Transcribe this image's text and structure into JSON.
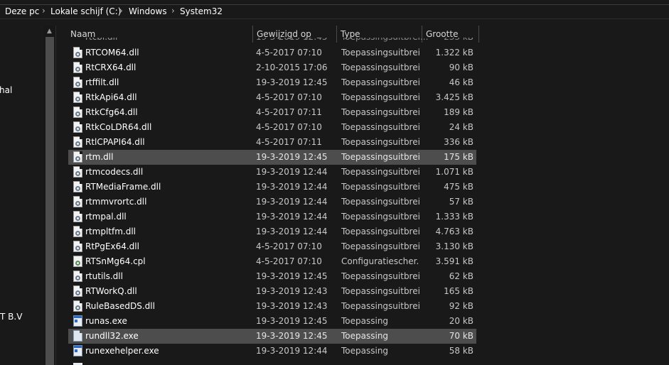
{
  "breadcrumb": {
    "items": [
      "Deze pc",
      "Lokale schijf (C:)",
      "Windows",
      "System32"
    ],
    "separator": "›"
  },
  "navpane": {
    "fragment1": "hal",
    "fragment2": "T B.V"
  },
  "columns": {
    "name": "Naam",
    "modified": "Gewijzigd op",
    "type": "Type",
    "size": "Grootte"
  },
  "files": [
    {
      "name": "RTCOM64.dll",
      "modified": "4-5-2017 07:10",
      "type": "Toepassingsuitbrei...",
      "size": "1.322 kB",
      "icon": "dll-file-icon",
      "selected": false
    },
    {
      "name": "RtCRX64.dll",
      "modified": "2-10-2015 17:06",
      "type": "Toepassingsuitbrei...",
      "size": "90 kB",
      "icon": "dll-file-icon",
      "selected": false
    },
    {
      "name": "rtffilt.dll",
      "modified": "19-3-2019 12:45",
      "type": "Toepassingsuitbrei...",
      "size": "46 kB",
      "icon": "dll-file-icon",
      "selected": false
    },
    {
      "name": "RtkApi64.dll",
      "modified": "4-5-2017 07:10",
      "type": "Toepassingsuitbrei...",
      "size": "3.425 kB",
      "icon": "dll-file-icon",
      "selected": false
    },
    {
      "name": "RtkCfg64.dll",
      "modified": "4-5-2017 07:11",
      "type": "Toepassingsuitbrei...",
      "size": "189 kB",
      "icon": "dll-file-icon",
      "selected": false
    },
    {
      "name": "RtkCoLDR64.dll",
      "modified": "4-5-2017 07:10",
      "type": "Toepassingsuitbrei...",
      "size": "24 kB",
      "icon": "dll-file-icon",
      "selected": false
    },
    {
      "name": "RtlCPAPI64.dll",
      "modified": "4-5-2017 07:11",
      "type": "Toepassingsuitbrei...",
      "size": "336 kB",
      "icon": "dll-file-icon",
      "selected": false
    },
    {
      "name": "rtm.dll",
      "modified": "19-3-2019 12:45",
      "type": "Toepassingsuitbrei...",
      "size": "175 kB",
      "icon": "dll-file-icon",
      "selected": true
    },
    {
      "name": "rtmcodecs.dll",
      "modified": "19-3-2019 12:44",
      "type": "Toepassingsuitbrei...",
      "size": "1.071 kB",
      "icon": "dll-file-icon",
      "selected": false
    },
    {
      "name": "RTMediaFrame.dll",
      "modified": "19-3-2019 12:44",
      "type": "Toepassingsuitbrei...",
      "size": "475 kB",
      "icon": "dll-file-icon",
      "selected": false
    },
    {
      "name": "rtmmvrortc.dll",
      "modified": "19-3-2019 12:44",
      "type": "Toepassingsuitbrei...",
      "size": "57 kB",
      "icon": "dll-file-icon",
      "selected": false
    },
    {
      "name": "rtmpal.dll",
      "modified": "19-3-2019 12:44",
      "type": "Toepassingsuitbrei...",
      "size": "1.333 kB",
      "icon": "dll-file-icon",
      "selected": false
    },
    {
      "name": "rtmpltfm.dll",
      "modified": "19-3-2019 12:44",
      "type": "Toepassingsuitbrei...",
      "size": "4.763 kB",
      "icon": "dll-file-icon",
      "selected": false
    },
    {
      "name": "RtPgEx64.dll",
      "modified": "4-5-2017 07:10",
      "type": "Toepassingsuitbrei...",
      "size": "3.130 kB",
      "icon": "dll-file-icon",
      "selected": false
    },
    {
      "name": "RTSnMg64.cpl",
      "modified": "4-5-2017 07:10",
      "type": "Configuratiescher...",
      "size": "3.591 kB",
      "icon": "cpl-file-icon",
      "selected": false
    },
    {
      "name": "rtutils.dll",
      "modified": "19-3-2019 12:45",
      "type": "Toepassingsuitbrei...",
      "size": "62 kB",
      "icon": "dll-file-icon",
      "selected": false
    },
    {
      "name": "RTWorkQ.dll",
      "modified": "19-3-2019 12:43",
      "type": "Toepassingsuitbrei...",
      "size": "165 kB",
      "icon": "dll-file-icon",
      "selected": false
    },
    {
      "name": "RuleBasedDS.dll",
      "modified": "19-3-2019 12:43",
      "type": "Toepassingsuitbrei...",
      "size": "92 kB",
      "icon": "dll-file-icon",
      "selected": false
    },
    {
      "name": "runas.exe",
      "modified": "19-3-2019 12:45",
      "type": "Toepassing",
      "size": "20 kB",
      "icon": "exe-file-icon",
      "selected": false
    },
    {
      "name": "rundll32.exe",
      "modified": "19-3-2019 12:45",
      "type": "Toepassing",
      "size": "70 kB",
      "icon": "blank-file-icon",
      "selected": true
    },
    {
      "name": "runexehelper.exe",
      "modified": "19-3-2019 12:44",
      "type": "Toepassing",
      "size": "58 kB",
      "icon": "exe-file-icon",
      "selected": false
    }
  ],
  "colors": {
    "background": "#191919",
    "selection": "#4d4d4d",
    "text": "#ffffff",
    "muted_text": "#c8c8c8"
  }
}
